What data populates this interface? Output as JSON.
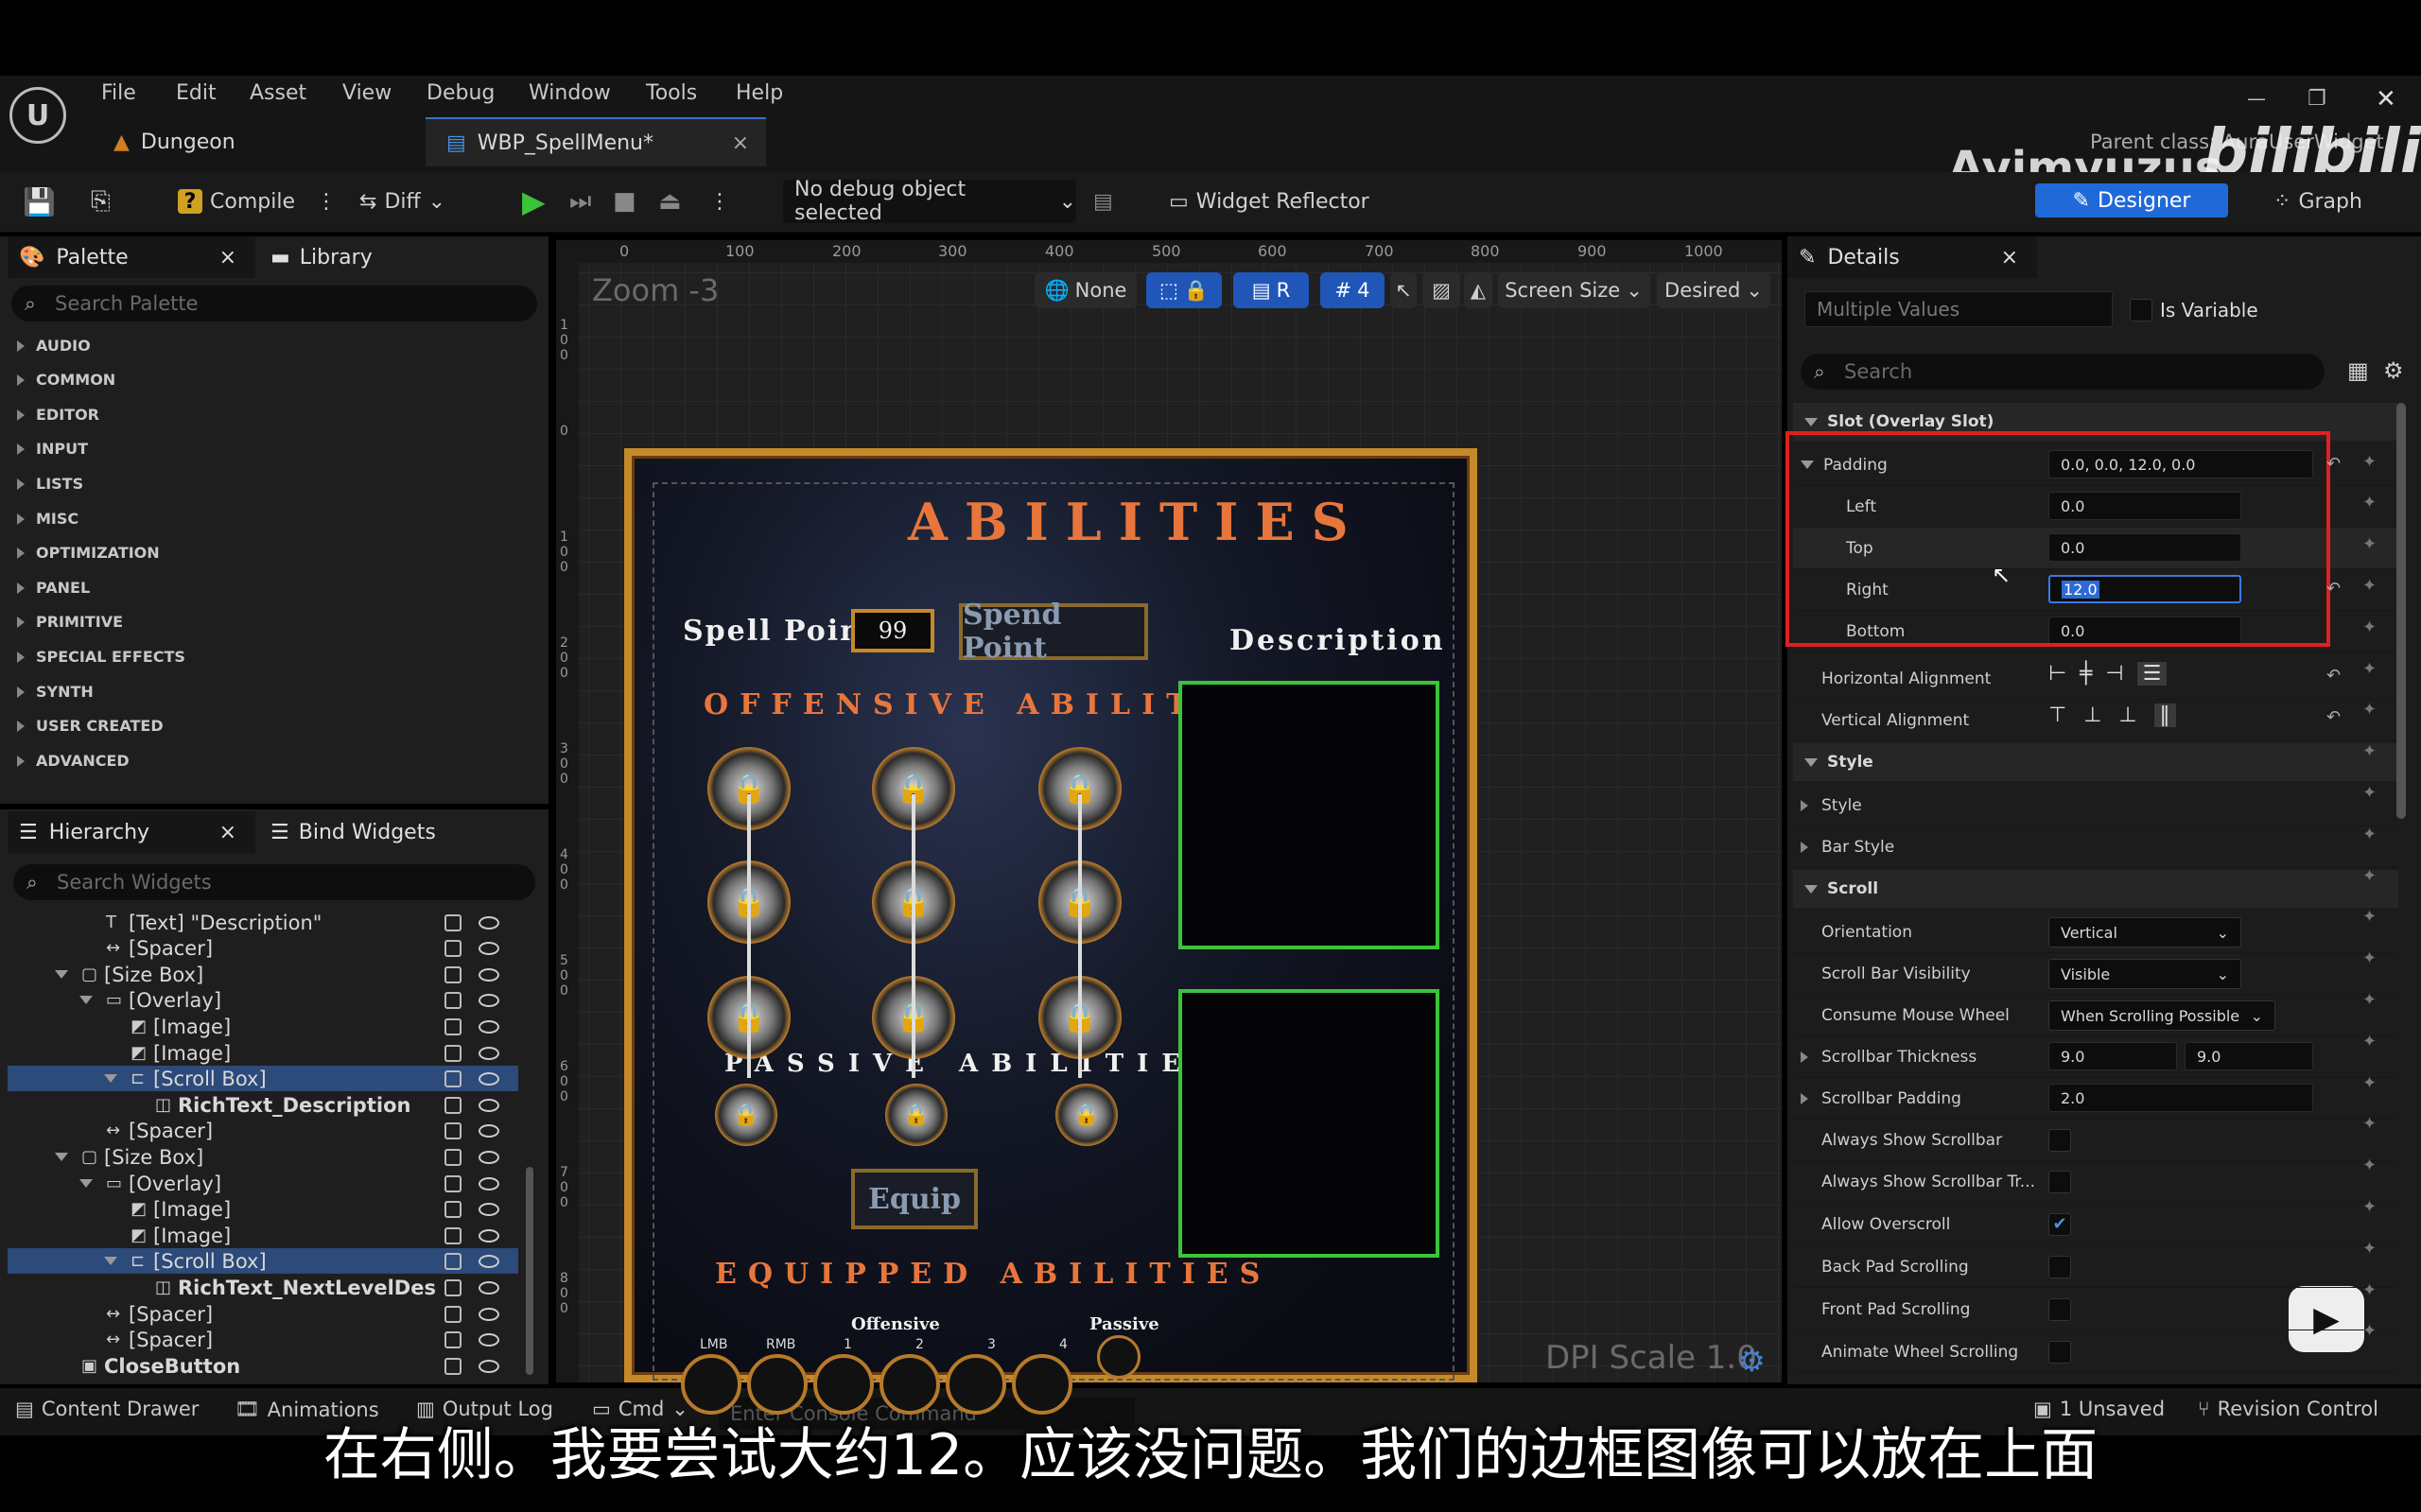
{
  "menu": [
    "File",
    "Edit",
    "Asset",
    "View",
    "Debug",
    "Window",
    "Tools",
    "Help"
  ],
  "tabs": {
    "level": "Dungeon",
    "widget": "WBP_SpellMenu*",
    "close": "×"
  },
  "window_controls": {
    "minimize": "—",
    "maximize": "❐",
    "close": "✕"
  },
  "parent_class": "Parent class: AuraUserWidget",
  "watermark": {
    "channel": "Ayimyuzus",
    "site": "bilibili"
  },
  "toolbar": {
    "compile": "Compile",
    "diff": "Diff",
    "debug_object": "No debug object selected",
    "reflector": "Widget Reflector",
    "designer": "Designer",
    "graph": "Graph"
  },
  "palette": {
    "title": "Palette",
    "library": "Library",
    "search_placeholder": "Search Palette",
    "categories": [
      "AUDIO",
      "COMMON",
      "EDITOR",
      "INPUT",
      "LISTS",
      "MISC",
      "OPTIMIZATION",
      "PANEL",
      "PRIMITIVE",
      "SPECIAL EFFECTS",
      "SYNTH",
      "USER CREATED",
      "ADVANCED"
    ]
  },
  "hierarchy": {
    "title": "Hierarchy",
    "bind": "Bind Widgets",
    "search_placeholder": "Search Widgets",
    "rows": [
      {
        "label": "[Text] \"Description\"",
        "icon": "T",
        "indent": 3,
        "selected": false
      },
      {
        "label": "[Spacer]",
        "icon": "↔",
        "indent": 3,
        "selected": false
      },
      {
        "label": "[Size Box]",
        "icon": "▢",
        "indent": 2,
        "selected": false,
        "expand": true
      },
      {
        "label": "[Overlay]",
        "icon": "▭",
        "indent": 3,
        "selected": false,
        "expand": true
      },
      {
        "label": "[Image]",
        "icon": "◩",
        "indent": 4,
        "selected": false
      },
      {
        "label": "[Image]",
        "icon": "◩",
        "indent": 4,
        "selected": false
      },
      {
        "label": "[Scroll Box]",
        "icon": "⊏",
        "indent": 4,
        "selected": true,
        "expand": true
      },
      {
        "label": "RichText_Description",
        "icon": "◫",
        "indent": 5,
        "selected": false,
        "bold": true
      },
      {
        "label": "[Spacer]",
        "icon": "↔",
        "indent": 3,
        "selected": false
      },
      {
        "label": "[Size Box]",
        "icon": "▢",
        "indent": 2,
        "selected": false,
        "expand": true
      },
      {
        "label": "[Overlay]",
        "icon": "▭",
        "indent": 3,
        "selected": false,
        "expand": true
      },
      {
        "label": "[Image]",
        "icon": "◩",
        "indent": 4,
        "selected": false
      },
      {
        "label": "[Image]",
        "icon": "◩",
        "indent": 4,
        "selected": false
      },
      {
        "label": "[Scroll Box]",
        "icon": "⊏",
        "indent": 4,
        "selected": true,
        "expand": true
      },
      {
        "label": "RichText_NextLevelDesc",
        "icon": "◫",
        "indent": 5,
        "selected": false,
        "bold": true
      },
      {
        "label": "[Spacer]",
        "icon": "↔",
        "indent": 3,
        "selected": false
      },
      {
        "label": "[Spacer]",
        "icon": "↔",
        "indent": 3,
        "selected": false
      },
      {
        "label": "CloseButton",
        "icon": "▣",
        "indent": 2,
        "selected": false,
        "bold": true
      }
    ]
  },
  "designer": {
    "zoom": "Zoom -3",
    "none": "None",
    "r": "R",
    "grid": "4",
    "screen_size": "Screen Size",
    "desired": "Desired",
    "dpi": "DPI Scale 1.0",
    "ruler": [
      "0",
      "100",
      "200",
      "300",
      "400",
      "500",
      "600",
      "700",
      "800",
      "900",
      "1000"
    ],
    "ruler_left": [
      "1\n0\n0",
      "0",
      "1\n0\n0",
      "2\n0\n0",
      "3\n0\n0",
      "4\n0\n0",
      "5\n0\n0",
      "6\n0\n0",
      "7\n0\n0",
      "8\n0\n0"
    ]
  },
  "game": {
    "title": "ABILITIES",
    "spell_points_label": "Spell Points",
    "spell_points": "99",
    "spend": "Spend Point",
    "description": "Description",
    "offensive": "OFFENSIVE ABILITIES",
    "passive": "PASSIVE ABILITIES",
    "equip": "Equip",
    "equipped": "EQUIPPED ABILITIES",
    "offense_label": "Offensive",
    "passive_label": "Passive",
    "lmb": "LMB",
    "rmb": "RMB",
    "slots": [
      "1",
      "2",
      "3",
      "4"
    ]
  },
  "details": {
    "title": "Details",
    "multiple": "Multiple Values",
    "is_variable": "Is Variable",
    "search_placeholder": "Search",
    "slot_section": "Slot (Overlay Slot)",
    "padding": {
      "label": "Padding",
      "value": "0.0, 0.0, 12.0, 0.0",
      "left_label": "Left",
      "left": "0.0",
      "top_label": "Top",
      "top": "0.0",
      "right_label": "Right",
      "right": "12.0",
      "bottom_label": "Bottom",
      "bottom": "0.0"
    },
    "halign": "Horizontal Alignment",
    "valign": "Vertical Alignment",
    "style_section": "Style",
    "style": "Style",
    "bar_style": "Bar Style",
    "scroll_section": "Scroll",
    "orientation_label": "Orientation",
    "orientation": "Vertical",
    "sbv_label": "Scroll Bar Visibility",
    "sbv": "Visible",
    "cmw_label": "Consume Mouse Wheel",
    "cmw": "When Scrolling Possible",
    "thick_label": "Scrollbar Thickness",
    "thick_x": "9.0",
    "thick_y": "9.0",
    "pad_label": "Scrollbar Padding",
    "pad": "2.0",
    "checks": [
      {
        "label": "Always Show Scrollbar",
        "checked": false
      },
      {
        "label": "Always Show Scrollbar Tr...",
        "checked": false
      },
      {
        "label": "Allow Overscroll",
        "checked": true
      },
      {
        "label": "Back Pad Scrolling",
        "checked": false
      },
      {
        "label": "Front Pad Scrolling",
        "checked": false
      },
      {
        "label": "Animate Wheel Scrolling",
        "checked": false
      }
    ]
  },
  "status": {
    "content": "Content Drawer",
    "anim": "Animations",
    "output": "Output Log",
    "cmd": "Cmd",
    "console": "Enter Console Command",
    "unsaved": "1 Unsaved",
    "revision": "Revision Control"
  },
  "subtitle": "在右侧。我要尝试大约12。应该没问题。我们的边框图像可以放在上面",
  "colors": {
    "accent": "#1f56b8",
    "highlight_red": "#e02020",
    "green": "#3ac43a",
    "gold": "#c5892a"
  }
}
